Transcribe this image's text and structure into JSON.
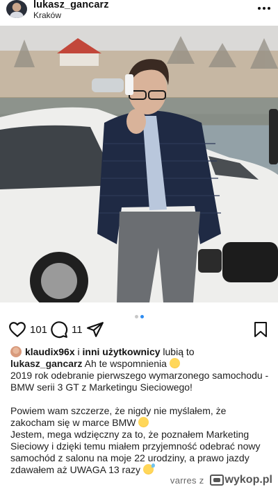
{
  "post": {
    "username": "lukasz_gancarz",
    "location": "Kraków",
    "photo_description_icons": [
      "more-icon"
    ],
    "likes_count": "101",
    "comments_count": "11",
    "likes_line": {
      "first_user": "klaudix96x",
      "connector": " i ",
      "others": "inni użytkownicy",
      "suffix": " lubią to"
    },
    "caption": {
      "user": "lukasz_gancarz",
      "line1": " Ah te wspomnienia",
      "para1": "2019 rok odebranie pierwszego wymarzonego samochodu - BMW serii 3 GT z Marketingu Sieciowego!",
      "para2": "Powiem wam szczerze, że nigdy nie myślałem, że zakocham się w marce BMW",
      "para3": "Jestem, mega wdzięczny za to, że poznałem Marketing Sieciowy i dzięki temu miałem przyjemność odebrać nowy samochód z salonu na moje 22 urodziny, a prawo jazdy zdawałem aż UWAGA 13 razy"
    },
    "carousel": {
      "count": 2,
      "active_index": 1
    }
  },
  "footer": {
    "author": "varres",
    "sep": "z",
    "site": "wykop.pl"
  },
  "colors": {
    "accent": "#2e8cf0",
    "text": "#111111"
  }
}
